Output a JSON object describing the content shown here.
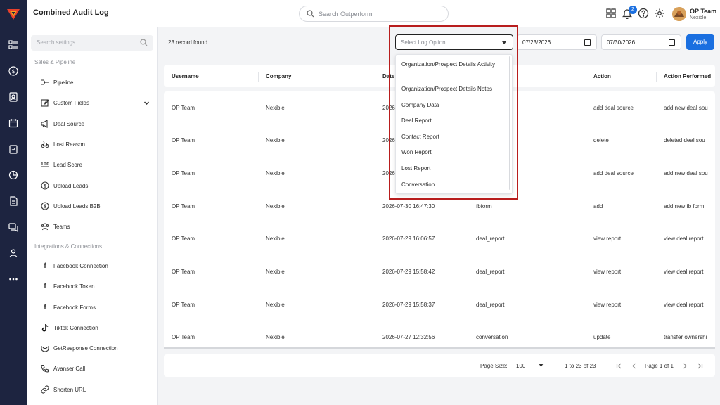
{
  "header": {
    "title": "Combined Audit Log",
    "search_placeholder": "Search Outperform",
    "notification_count": "2",
    "user_name": "OP Team",
    "user_org": "Nexible"
  },
  "sidebar": {
    "search_placeholder": "Search settings...",
    "groups": [
      "Sales & Pipeline",
      "Integrations & Connections"
    ],
    "items": [
      {
        "label": "Pipeline",
        "icon": "pipeline-icon"
      },
      {
        "label": "Custom Fields",
        "icon": "edit-icon"
      },
      {
        "label": "Deal Source",
        "icon": "megaphone-icon"
      },
      {
        "label": "Lost Reason",
        "icon": "bicycle-icon"
      },
      {
        "label": "Lead Score",
        "icon": "score-icon"
      },
      {
        "label": "Upload Leads",
        "icon": "dollar-circle-icon"
      },
      {
        "label": "Upload Leads B2B",
        "icon": "dollar-circle-icon"
      },
      {
        "label": "Teams",
        "icon": "teams-icon"
      },
      {
        "label": "Facebook Connection",
        "icon": "facebook-icon"
      },
      {
        "label": "Facebook Token",
        "icon": "facebook-icon"
      },
      {
        "label": "Facebook Forms",
        "icon": "facebook-icon"
      },
      {
        "label": "Tiktok Connection",
        "icon": "tiktok-icon"
      },
      {
        "label": "GetResponse Connection",
        "icon": "getresponse-icon"
      },
      {
        "label": "Avanser Call",
        "icon": "phone-icon"
      },
      {
        "label": "Shorten URL",
        "icon": "link-icon"
      }
    ]
  },
  "toolbar": {
    "record_count": "23 record found.",
    "log_option_placeholder": "Select Log Option",
    "date_from": "07/23/2026",
    "date_to": "07/30/2026",
    "apply_label": "Apply"
  },
  "dropdown": {
    "options": [
      "Organization/Prospect Details Activity",
      "Organization/Prospect Details Notes",
      "Company Data",
      "Deal Report",
      "Contact Report",
      "Won Report",
      "Lost Report",
      "Conversation"
    ]
  },
  "table": {
    "columns": [
      "Username",
      "Company",
      "Date",
      "",
      "Action",
      "Action Performed"
    ],
    "rows": [
      {
        "username": "OP Team",
        "company": "Nexible",
        "date": "2026",
        "type": "",
        "action": "add deal source",
        "performed": "add new deal sou"
      },
      {
        "username": "OP Team",
        "company": "Nexible",
        "date": "2026",
        "type": "",
        "action": "delete",
        "performed": "deleted deal sou"
      },
      {
        "username": "OP Team",
        "company": "Nexible",
        "date": "2026",
        "type": "",
        "action": "add deal source",
        "performed": "add new deal sou"
      },
      {
        "username": "OP Team",
        "company": "Nexible",
        "date": "2026-07-30 16:47:30",
        "type": "fbform",
        "action": "add",
        "performed": "add new fb form"
      },
      {
        "username": "OP Team",
        "company": "Nexible",
        "date": "2026-07-29 16:06:57",
        "type": "deal_report",
        "action": "view report",
        "performed": "view deal report"
      },
      {
        "username": "OP Team",
        "company": "Nexible",
        "date": "2026-07-29 15:58:42",
        "type": "deal_report",
        "action": "view report",
        "performed": "view deal report"
      },
      {
        "username": "OP Team",
        "company": "Nexible",
        "date": "2026-07-29 15:58:37",
        "type": "deal_report",
        "action": "view report",
        "performed": "view deal report"
      },
      {
        "username": "OP Team",
        "company": "Nexible",
        "date": "2026-07-27 12:32:56",
        "type": "conversation",
        "action": "update",
        "performed": "transfer ownershi"
      }
    ]
  },
  "pager": {
    "page_size_label": "Page Size:",
    "page_size": "100",
    "range": "1 to 23 of 23",
    "page_info": "Page 1 of 1"
  },
  "colors": {
    "rail": "#1d2440",
    "accent": "#1a6fe0",
    "highlight": "#b81d1d"
  }
}
